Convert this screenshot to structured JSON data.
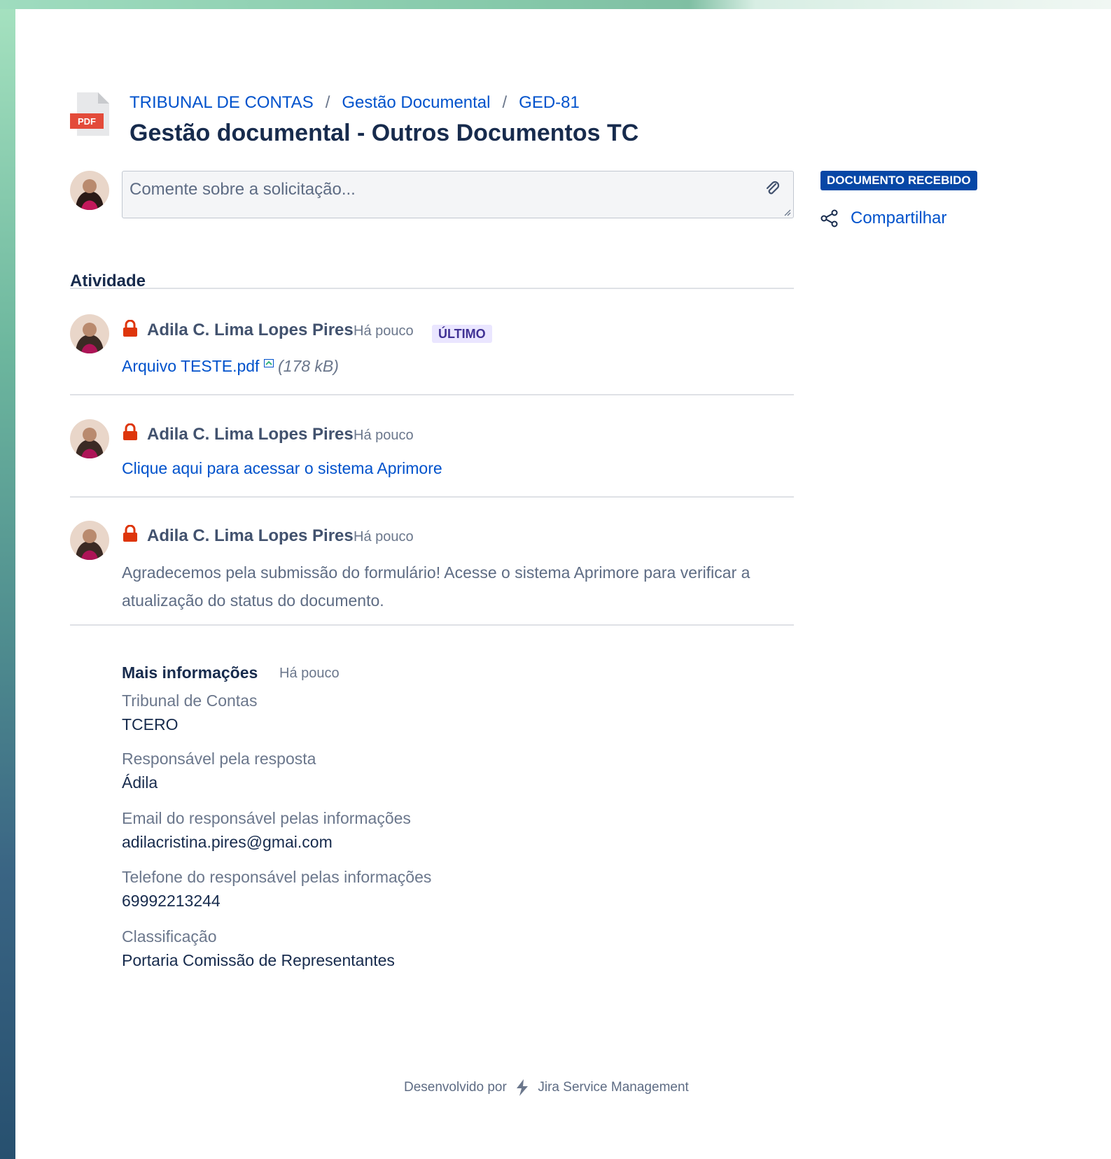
{
  "breadcrumb": {
    "items": [
      "TRIBUNAL DE CONTAS",
      "Gestão Documental",
      "GED-81"
    ],
    "separator": "/"
  },
  "page": {
    "title": "Gestão documental - Outros Documentos TC",
    "icon": "pdf-file-icon",
    "icon_label": "PDF"
  },
  "comment": {
    "placeholder": "Comente sobre a solicitação..."
  },
  "status": {
    "label": "DOCUMENTO RECEBIDO",
    "color": "#0747a6"
  },
  "share": {
    "label": "Compartilhar"
  },
  "activity": {
    "heading": "Atividade",
    "items": [
      {
        "author": "Adila C. Lima Lopes Pires",
        "time": "Há pouco",
        "badge": "ÚLTIMO",
        "link_text": "Arquivo TESTE.pdf",
        "file_size": "(178 kB)"
      },
      {
        "author": "Adila C. Lima Lopes Pires",
        "time": "Há pouco",
        "link_text": "Clique aqui para acessar o sistema Aprimore"
      },
      {
        "author": "Adila C. Lima Lopes Pires",
        "time": "Há pouco",
        "body": "Agradecemos pela submissão do formulário! Acesse o sistema Aprimore para verificar a atualização do status do documento."
      }
    ]
  },
  "more_info": {
    "title": "Mais informações",
    "time": "Há pouco",
    "fields": [
      {
        "label": "Tribunal de Contas",
        "value": "TCERO"
      },
      {
        "label": "Responsável pela resposta",
        "value": "Ádila"
      },
      {
        "label": "Email do responsável pelas informações",
        "value": "adilacristina.pires@gmai.com"
      },
      {
        "label": "Telefone do responsável pelas informações",
        "value": "69992213244"
      },
      {
        "label": "Classificação",
        "value": "Portaria Comissão de Representantes"
      }
    ]
  },
  "footer": {
    "prefix": "Desenvolvido por",
    "product": "Jira Service Management"
  },
  "colors": {
    "link": "#0052cc",
    "lock": "#de350b",
    "latest_badge_bg": "#eae6ff",
    "latest_badge_text": "#403294"
  }
}
